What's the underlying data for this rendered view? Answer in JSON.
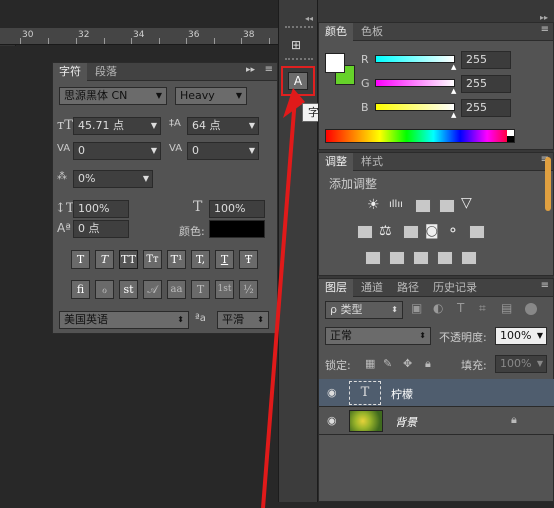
{
  "ruler": {
    "ticks": [
      "30",
      "32",
      "34",
      "36",
      "38"
    ]
  },
  "character_panel": {
    "tabs": [
      "字符",
      "段落"
    ],
    "font_family": "思源黑体 CN",
    "font_style": "Heavy",
    "font_size": "45.71 点",
    "leading": "64 点",
    "kerning": "0",
    "tracking": "0",
    "vertical_scale_pct": "0%",
    "horizontal_scale_1": "100%",
    "horizontal_scale_2": "100%",
    "baseline_shift": "0 点",
    "color_label": "颜色:",
    "style_buttons": [
      "T",
      "T",
      "TT",
      "Tт",
      "T¹",
      "T,",
      "T",
      "Ŧ"
    ],
    "opentype_buttons": [
      "fi",
      "ℴ",
      "st",
      "𝒜",
      "aa",
      "T",
      "1st",
      "½"
    ],
    "language": "美国英语",
    "aa_label": "ªa",
    "antialias": "平滑"
  },
  "tooltip": {
    "text": "字符"
  },
  "color_panel": {
    "tabs": [
      "颜色",
      "色板"
    ],
    "channels": [
      {
        "name": "R",
        "value": "255"
      },
      {
        "name": "G",
        "value": "255"
      },
      {
        "name": "B",
        "value": "255"
      }
    ],
    "colors": {
      "foreground": "#ffffff",
      "background": "#66d22a",
      "r": "#ff3030",
      "g": "#e63ae6",
      "b": "#f0f020"
    }
  },
  "adjustments_panel": {
    "tabs": [
      "调整",
      "样式"
    ],
    "title": "添加调整"
  },
  "layers_panel": {
    "tabs": [
      "图层",
      "通道",
      "路径",
      "历史记录"
    ],
    "filter_kind": "ρ 类型",
    "blend_mode": "正常",
    "opacity_label": "不透明度:",
    "opacity": "100%",
    "lock_label": "锁定:",
    "fill_label": "填充:",
    "fill": "100%",
    "layers": [
      {
        "name": "柠檬",
        "type": "text",
        "selected": true
      },
      {
        "name": "背景",
        "type": "image",
        "locked": true
      }
    ]
  }
}
